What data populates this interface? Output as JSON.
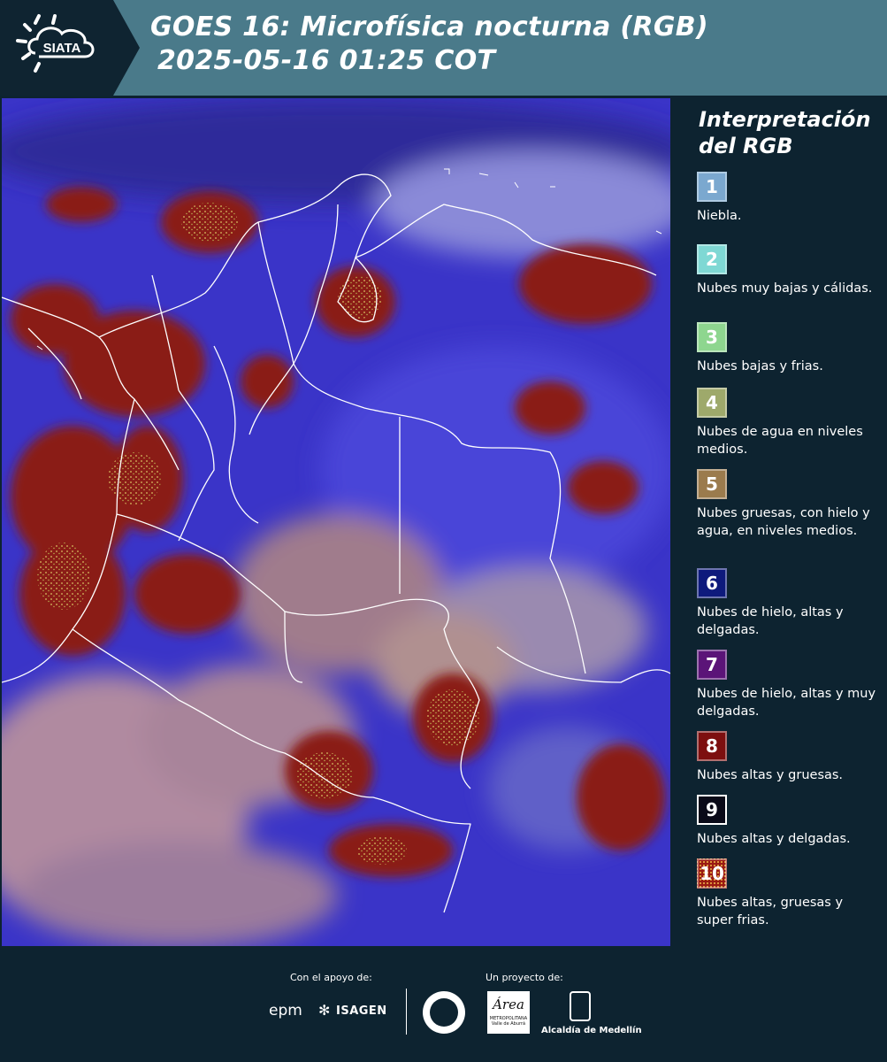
{
  "header": {
    "logo_text": "SIATA",
    "title_line1": "GOES 16: Microfísica nocturna (RGB)",
    "title_line2": "2025-05-16 01:25 COT"
  },
  "legend": {
    "title_line1": "Interpretación",
    "title_line2": "del RGB",
    "items": [
      {
        "num": "1",
        "color": "#7ba8cf",
        "text": "Niebla."
      },
      {
        "num": "2",
        "color": "#7fd8d4",
        "text": "Nubes muy bajas y cálidas."
      },
      {
        "num": "3",
        "color": "#8ed68f",
        "text": "Nubes bajas y frias."
      },
      {
        "num": "4",
        "color": "#9ea96b",
        "text": "Nubes de agua en niveles medios."
      },
      {
        "num": "5",
        "color": "#9b7b4d",
        "text": "Nubes gruesas, con hielo y agua, en niveles medios."
      },
      {
        "num": "6",
        "color": "#0e1a7c",
        "text": "Nubes de hielo, altas y delgadas."
      },
      {
        "num": "7",
        "color": "#5b1478",
        "text": "Nubes de hielo, altas y muy delgadas."
      },
      {
        "num": "8",
        "color": "#7d0f0f",
        "text": "Nubes altas y gruesas."
      },
      {
        "num": "9",
        "color": "#0a0a18",
        "text": "Nubes altas y delgadas."
      },
      {
        "num": "10",
        "color": "#9a1a12",
        "text": "Nubes altas, gruesas y super frias."
      }
    ]
  },
  "footer": {
    "support_label": "Con el apoyo de:",
    "project_label": "Un proyecto de:",
    "epm": "epm",
    "isagen": "ISAGEN",
    "area_name": "Área",
    "area_sub1": "METROPOLITANA",
    "area_sub2": "Valle de Aburrá",
    "alcaldia": "Alcaldía de Medellín"
  },
  "map": {
    "description_icon": "satellite-image"
  }
}
